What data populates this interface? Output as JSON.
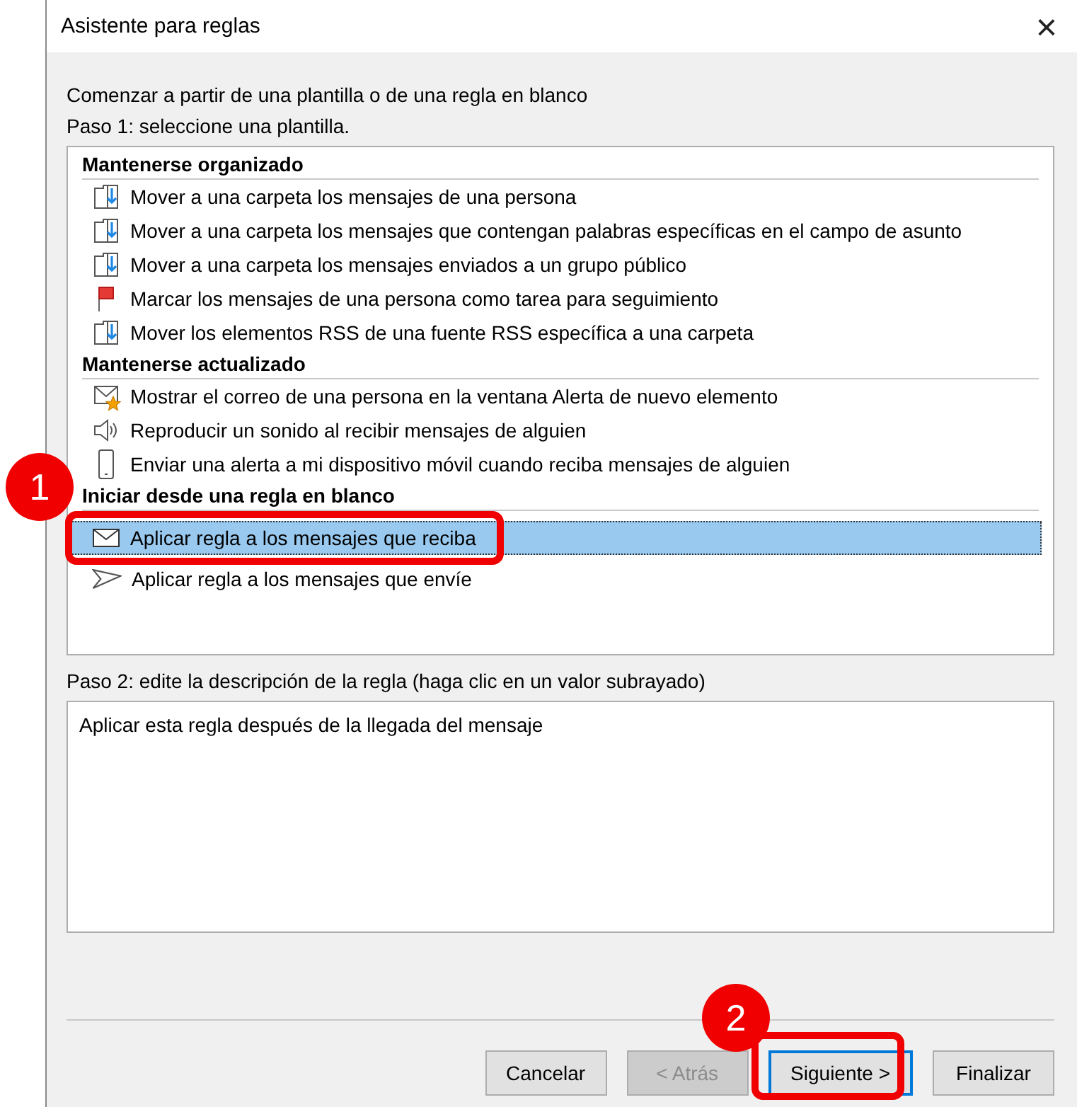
{
  "window": {
    "title": "Asistente para reglas",
    "close": "×"
  },
  "intro": "Comenzar a partir de una plantilla o de una regla en blanco",
  "step1": "Paso 1: seleccione una plantilla.",
  "groups": [
    {
      "heading": "Mantenerse organizado",
      "items": [
        {
          "kind": "move",
          "label": "Mover a una carpeta los mensajes de una persona",
          "selected": false
        },
        {
          "kind": "move",
          "label": "Mover a una carpeta los mensajes que contengan palabras específicas en el campo de asunto",
          "selected": false
        },
        {
          "kind": "move",
          "label": "Mover a una carpeta los mensajes enviados a un grupo público",
          "selected": false
        },
        {
          "kind": "flag",
          "label": "Marcar los mensajes de una persona como tarea para seguimiento",
          "selected": false
        },
        {
          "kind": "move",
          "label": "Mover los elementos RSS de una fuente RSS específica a una carpeta",
          "selected": false
        }
      ]
    },
    {
      "heading": "Mantenerse actualizado",
      "items": [
        {
          "kind": "alert",
          "label": "Mostrar el correo de una persona en la ventana Alerta de nuevo elemento",
          "selected": false
        },
        {
          "kind": "sound",
          "label": "Reproducir un sonido al recibir mensajes de alguien",
          "selected": false
        },
        {
          "kind": "phone",
          "label": "Enviar una alerta a mi dispositivo móvil cuando reciba mensajes de alguien",
          "selected": false
        }
      ]
    },
    {
      "heading": "Iniciar desde una regla en blanco",
      "items": [
        {
          "kind": "receive",
          "label": "Aplicar regla a los mensajes que reciba",
          "selected": true
        },
        {
          "kind": "send",
          "label": "Aplicar regla a los mensajes que envíe",
          "selected": false
        }
      ]
    }
  ],
  "step2": "Paso 2: edite la descripción de la regla (haga clic en un valor subrayado)",
  "description": "Aplicar esta regla después de la llegada del mensaje",
  "buttons": [
    {
      "label": "Cancelar",
      "disabled": false,
      "focused": false
    },
    {
      "label": "< Atrás",
      "disabled": true,
      "focused": false
    },
    {
      "label": "Siguiente >",
      "disabled": false,
      "focused": true
    },
    {
      "label": "Finalizar",
      "disabled": false,
      "focused": false
    }
  ],
  "annotations": [
    {
      "number": "1"
    },
    {
      "number": "2"
    }
  ]
}
